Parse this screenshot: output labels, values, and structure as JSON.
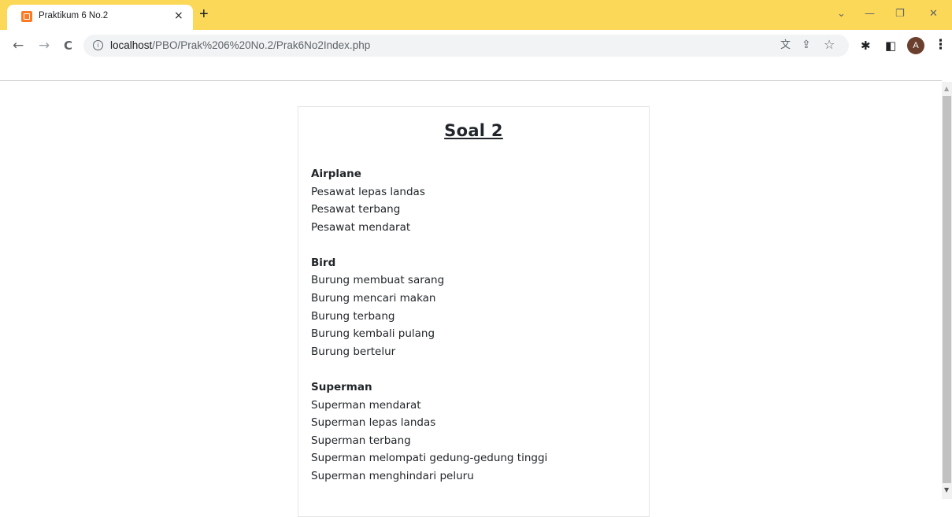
{
  "browser": {
    "tab": {
      "title": "Praktikum 6 No.2",
      "close": "×",
      "favicon": "xampp-icon"
    },
    "new_tab": "+",
    "window_controls": [
      "⌄",
      "—",
      "❐",
      "✕"
    ],
    "nav": {
      "back": "←",
      "forward": "→",
      "reload": "C"
    },
    "url": {
      "host": "localhost",
      "path": "/PBO/Prak%206%20No.2/Prak6No2Index.php"
    },
    "toolbar_icons": [
      "translate-icon",
      "share-icon",
      "bookmark-star-icon",
      "extensions-icon",
      "side-panel-icon"
    ],
    "avatar_letter": "A",
    "menu": "⋮",
    "accent_color": "#fbd858"
  },
  "page": {
    "title": "Soal 2",
    "groups": [
      {
        "name": "Airplane",
        "lines": [
          "Pesawat lepas landas",
          "Pesawat terbang",
          "Pesawat mendarat"
        ]
      },
      {
        "name": "Bird",
        "lines": [
          "Burung membuat sarang",
          "Burung mencari makan",
          "Burung terbang",
          "Burung kembali pulang",
          "Burung bertelur"
        ]
      },
      {
        "name": "Superman",
        "lines": [
          "Superman mendarat",
          "Superman lepas landas",
          "Superman terbang",
          "Superman melompati gedung-gedung tinggi",
          "Superman menghindari peluru"
        ]
      }
    ]
  }
}
